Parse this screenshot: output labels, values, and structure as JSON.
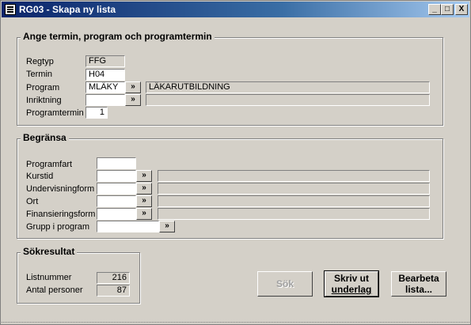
{
  "window": {
    "title": "RG03 - Skapa ny lista",
    "minimize_label": "_",
    "maximize_label": "□",
    "close_label": "X"
  },
  "group_termin": {
    "title": "Ange termin, program och programtermin",
    "regtyp_label": "Regtyp",
    "regtyp_value": "FFG",
    "termin_label": "Termin",
    "termin_value": "H04",
    "program_label": "Program",
    "program_value": "MLÄKY",
    "program_name": "LÄKARUTBILDNING",
    "inriktning_label": "Inriktning",
    "inriktning_value": "",
    "inriktning_name": "",
    "programtermin_label": "Programtermin",
    "programtermin_value": "1",
    "picker_label": "»"
  },
  "group_begransa": {
    "title": "Begränsa",
    "programfart_label": "Programfart",
    "kurstid_label": "Kurstid",
    "undervisningform_label": "Undervisningform",
    "ort_label": "Ort",
    "finansieringsform_label": "Finansieringsform",
    "grupp_label": "Grupp i program",
    "picker_label": "»"
  },
  "group_sokresultat": {
    "title": "Sökresultat",
    "listnummer_label": "Listnummer",
    "listnummer_value": "216",
    "antal_label": "Antal personer",
    "antal_value": "87"
  },
  "buttons": {
    "sok": "Sök",
    "skriv_line1": "Skriv ut",
    "skriv_line2": "underlag",
    "bearbeta_line1": "Bearbeta",
    "bearbeta_line2": "lista..."
  }
}
